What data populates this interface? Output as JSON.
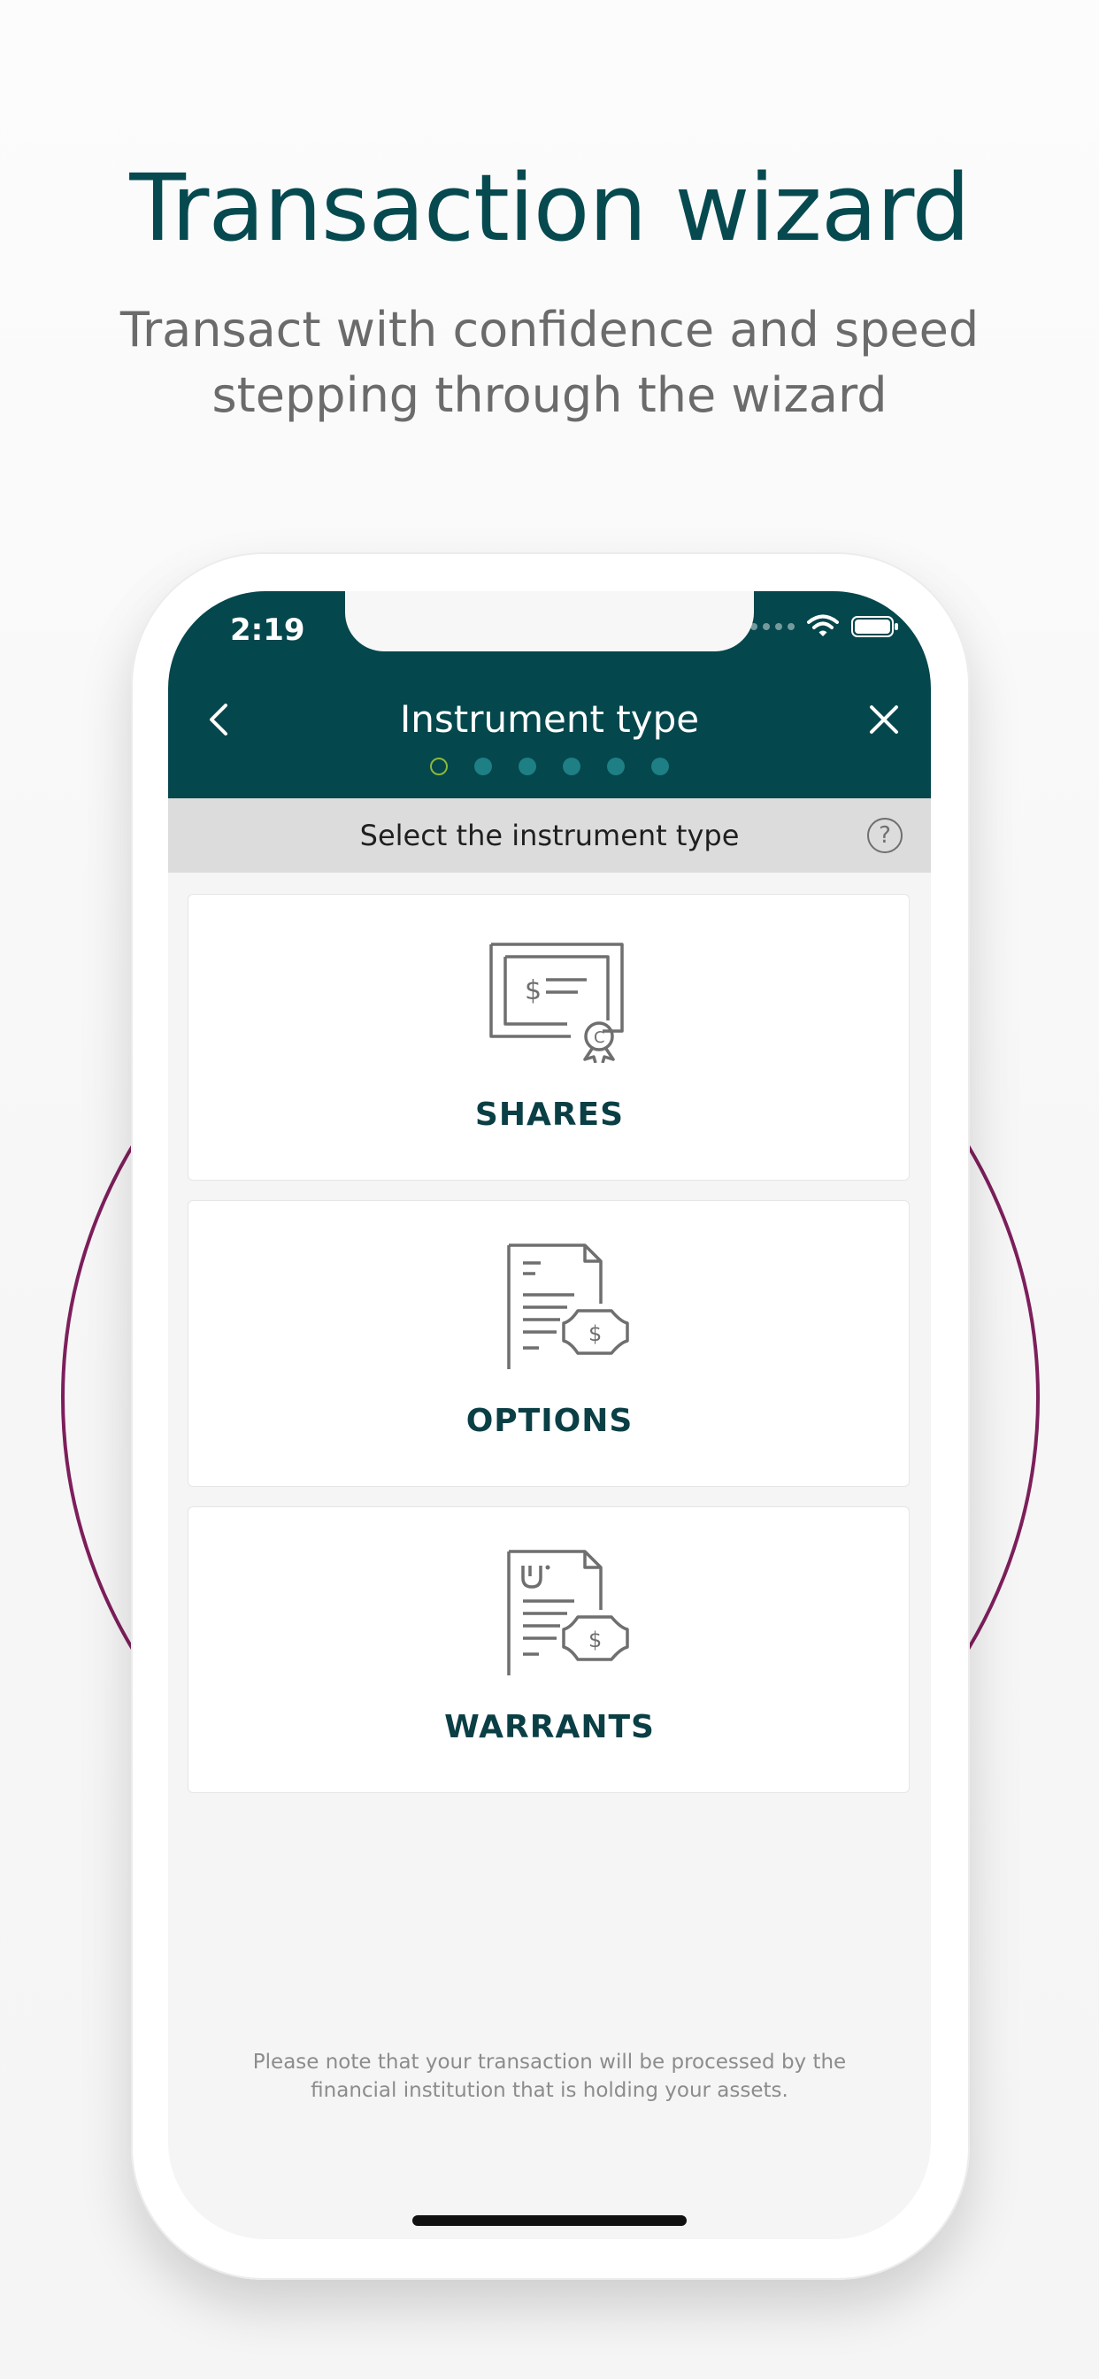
{
  "promo": {
    "title": "Transaction wizard",
    "subtitle": "Transact with confidence and speed stepping through the wizard"
  },
  "status_bar": {
    "time": "2:19"
  },
  "header": {
    "title": "Instrument type",
    "back_icon": "chevron-left-icon",
    "close_icon": "close-icon",
    "steps_total": 6,
    "current_step": 1
  },
  "subheader": {
    "text": "Select the instrument type",
    "help_label": "?"
  },
  "instruments": [
    {
      "label": "SHARES",
      "icon": "share-certificate-icon"
    },
    {
      "label": "OPTIONS",
      "icon": "options-document-icon"
    },
    {
      "label": "WARRANTS",
      "icon": "warrant-document-icon"
    }
  ],
  "footer": {
    "note": "Please note that your transaction will be processed by the financial institution that is holding your assets."
  },
  "colors": {
    "brand": "#04474d",
    "accent_ring": "#7d1f5b",
    "step_current": "#8bb83a",
    "step_pending": "#1e7f85"
  }
}
